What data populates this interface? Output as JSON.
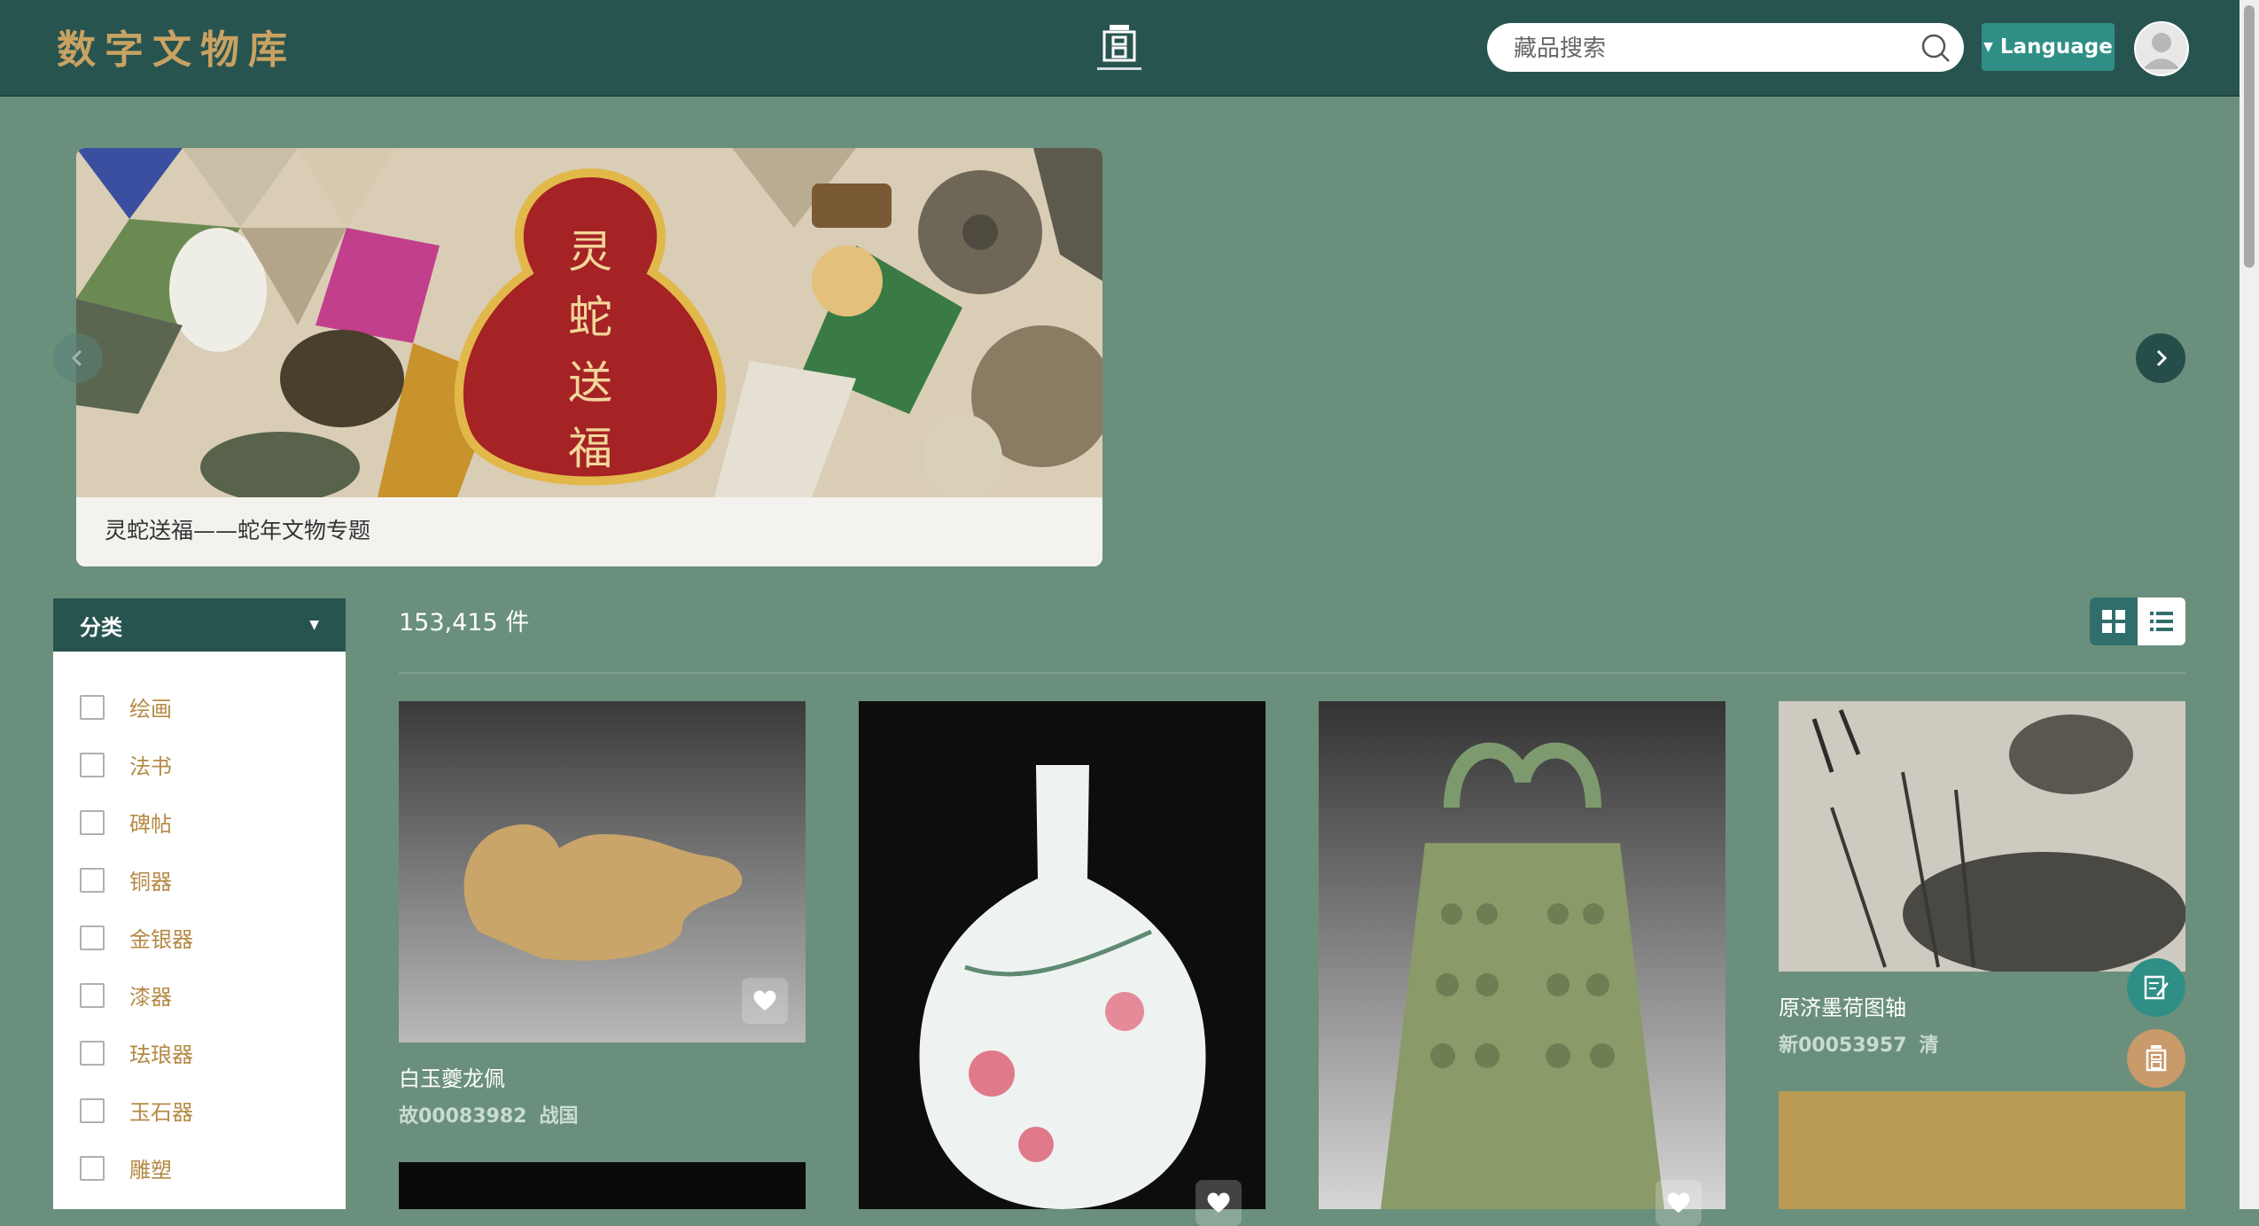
{
  "header": {
    "site_title": "数字文物库",
    "search_placeholder": "藏品搜索",
    "language_label": "Language"
  },
  "banner": {
    "headline_chars": [
      "灵",
      "蛇",
      "送",
      "福"
    ],
    "caption": "灵蛇送福——蛇年文物专题"
  },
  "sidebar": {
    "heading": "分类",
    "items": [
      {
        "label": "绘画"
      },
      {
        "label": "法书"
      },
      {
        "label": "碑帖"
      },
      {
        "label": "铜器"
      },
      {
        "label": "金银器"
      },
      {
        "label": "漆器"
      },
      {
        "label": "珐琅器"
      },
      {
        "label": "玉石器"
      },
      {
        "label": "雕塑"
      }
    ]
  },
  "results": {
    "count_text": "153,415 件",
    "view_modes": [
      "grid-icon",
      "list-icon"
    ],
    "active_view": "grid"
  },
  "cards": [
    {
      "title": "白玉夔龙佩",
      "id": "故00083982",
      "era": "战国"
    },
    {
      "title": "",
      "id": "",
      "era": ""
    },
    {
      "title": "",
      "id": "",
      "era": ""
    },
    {
      "title": "原济墨荷图轴",
      "id": "新00053957",
      "era": "清"
    }
  ],
  "colors": {
    "page_bg": "#6a8f7c",
    "header_bg": "#285450",
    "accent_gold": "#c9a262",
    "accent_teal": "#2f8f86"
  }
}
